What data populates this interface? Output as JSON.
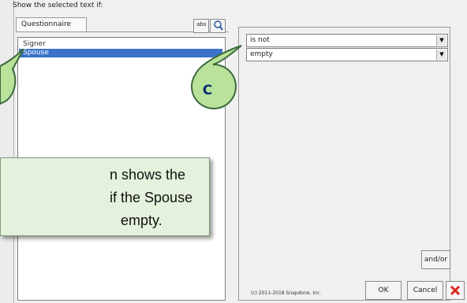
{
  "dialog": {
    "title": "Show the selected text if:",
    "tab": "Questionnaire",
    "abs_button": "abs",
    "search_icon": "magnifier-icon",
    "list_items": [
      "Signer",
      "Spouse"
    ],
    "selected_item": "Spouse",
    "condition_operator": "is not",
    "condition_value": "empty",
    "andor_label": "and/or",
    "copyright": "(c) 2011-2018 Snapdone, Inc.",
    "ok_label": "OK",
    "cancel_label": "Cancel",
    "close_icon": "close-icon"
  },
  "callout": {
    "letter": "C",
    "tip_lines": [
      "n shows the",
      "if the Spouse",
      "empty."
    ]
  },
  "colors": {
    "selection": "#3a73c9",
    "callout_bubble": "#b9e29a",
    "callout_border": "#3d6a3d",
    "tip_bg": "#e4f1dc",
    "close_red": "#d9271c"
  }
}
